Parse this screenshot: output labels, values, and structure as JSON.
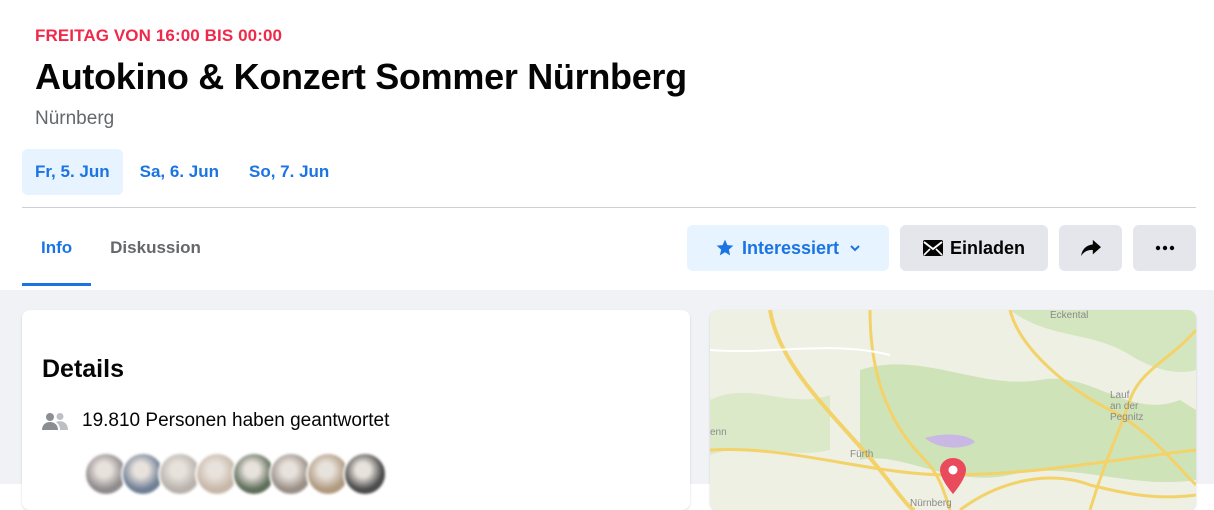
{
  "event": {
    "date_line": "FREITAG VON 16:00 BIS 00:00",
    "title": "Autokino & Konzert Sommer Nürnberg",
    "location": "Nürnberg"
  },
  "day_tabs": [
    {
      "label": "Fr, 5. Jun",
      "active": true
    },
    {
      "label": "Sa, 6. Jun",
      "active": false
    },
    {
      "label": "So, 7. Jun",
      "active": false
    }
  ],
  "nav_tabs": [
    {
      "label": "Info",
      "active": true
    },
    {
      "label": "Diskussion",
      "active": false
    }
  ],
  "actions": {
    "interested_label": "Interessiert",
    "invite_label": "Einladen",
    "share_icon": "share-arrow-icon",
    "more_icon": "more-dots-icon"
  },
  "details": {
    "title": "Details",
    "responses_text": "19.810 Personen haben geantwortet",
    "avatar_colors": [
      "#8f8a8c",
      "#6f7f95",
      "#b9b2ac",
      "#c7b8a8",
      "#5f6e5a",
      "#9a8f87",
      "#b09a80",
      "#4b4b4b"
    ]
  },
  "map": {
    "labels": [
      "Eckental",
      "Lauf an der Pegnitz",
      "Fürth",
      "enn",
      "Nürnberg"
    ]
  },
  "colors": {
    "date_red": "#f02849",
    "accent_blue": "#1b74e4",
    "map_pin": "#e94a5c"
  }
}
